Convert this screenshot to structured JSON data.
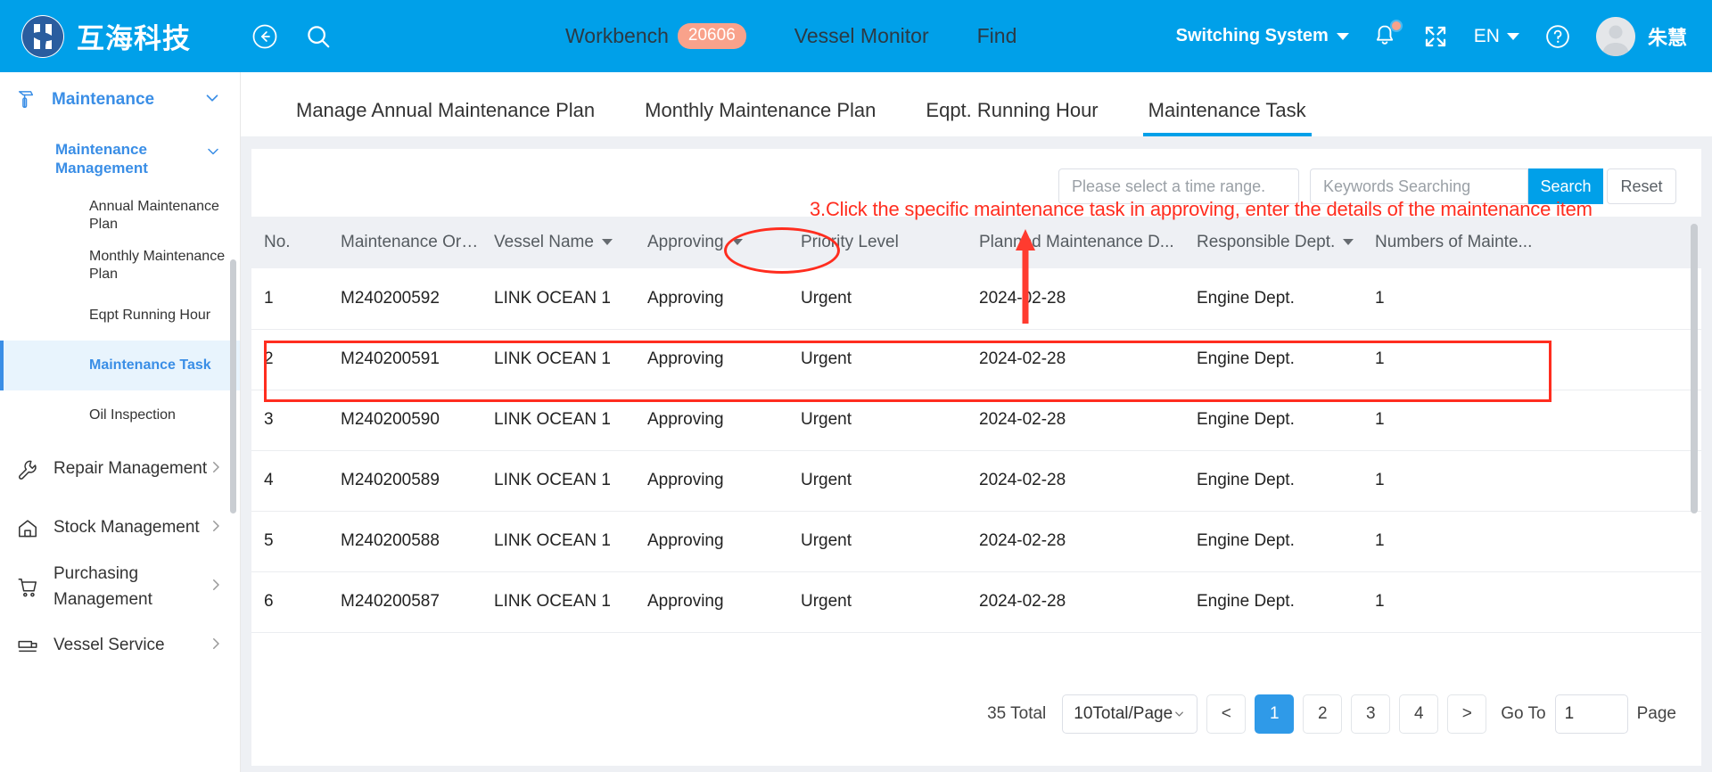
{
  "header": {
    "brand_name": "互海科技",
    "logo_icon": "company-logo-icon",
    "back_icon": "back-arrow-icon",
    "search_icon": "search-icon",
    "nav": [
      {
        "label": "Workbench",
        "badge": "20606"
      },
      {
        "label": "Vessel Monitor",
        "badge": ""
      },
      {
        "label": "Find",
        "badge": ""
      }
    ],
    "switch_system": "Switching System",
    "bell_icon": "notification-bell-icon",
    "fullscreen_icon": "fullscreen-icon",
    "language": "EN",
    "help_icon": "help-circle-icon",
    "avatar_icon": "user-avatar-icon",
    "user_name": "朱慧"
  },
  "sidebar": {
    "top": {
      "label": "Maintenance",
      "icon": "hammer-icon"
    },
    "group": {
      "label": "Maintenance Management"
    },
    "sub_items": [
      {
        "label": "Annual Maintenance Plan",
        "active": false
      },
      {
        "label": "Monthly Maintenance Plan",
        "active": false
      },
      {
        "label": "Eqpt Running Hour",
        "active": false
      },
      {
        "label": "Maintenance Task",
        "active": true
      },
      {
        "label": "Oil Inspection",
        "active": false
      }
    ],
    "items": [
      {
        "label": "Repair Management",
        "icon": "wrench-icon"
      },
      {
        "label": "Stock Management",
        "icon": "home-icon"
      },
      {
        "label": "Purchasing Management",
        "icon": "cart-icon"
      },
      {
        "label": "Vessel Service",
        "icon": "ship-icon"
      }
    ]
  },
  "main": {
    "tabs": [
      {
        "label": "Manage Annual Maintenance Plan",
        "active": false
      },
      {
        "label": "Monthly Maintenance Plan",
        "active": false
      },
      {
        "label": "Eqpt. Running Hour",
        "active": false
      },
      {
        "label": "Maintenance Task",
        "active": true
      }
    ],
    "toolbar": {
      "time_range_placeholder": "Please select a time range.",
      "keywords_placeholder": "Keywords Searching",
      "search_label": "Search",
      "reset_label": "Reset"
    },
    "table": {
      "columns": [
        {
          "label": "No.",
          "sortable": false
        },
        {
          "label": "Maintenance Order...",
          "sortable": false
        },
        {
          "label": "Vessel Name",
          "sortable": true
        },
        {
          "label": "Approving",
          "sortable": true
        },
        {
          "label": "Priority Level",
          "sortable": false
        },
        {
          "label": "Planned Maintenance D...",
          "sortable": false
        },
        {
          "label": "Responsible Dept.",
          "sortable": true
        },
        {
          "label": "Numbers of Mainte...",
          "sortable": false
        }
      ],
      "rows": [
        {
          "no": "1",
          "order": "M240200592",
          "vessel": "LINK OCEAN 1",
          "approving": "Approving",
          "priority": "Urgent",
          "date": "2024-02-28",
          "dept": "Engine Dept.",
          "numbers": "1"
        },
        {
          "no": "2",
          "order": "M240200591",
          "vessel": "LINK OCEAN 1",
          "approving": "Approving",
          "priority": "Urgent",
          "date": "2024-02-28",
          "dept": "Engine Dept.",
          "numbers": "1"
        },
        {
          "no": "3",
          "order": "M240200590",
          "vessel": "LINK OCEAN 1",
          "approving": "Approving",
          "priority": "Urgent",
          "date": "2024-02-28",
          "dept": "Engine Dept.",
          "numbers": "1"
        },
        {
          "no": "4",
          "order": "M240200589",
          "vessel": "LINK OCEAN 1",
          "approving": "Approving",
          "priority": "Urgent",
          "date": "2024-02-28",
          "dept": "Engine Dept.",
          "numbers": "1"
        },
        {
          "no": "5",
          "order": "M240200588",
          "vessel": "LINK OCEAN 1",
          "approving": "Approving",
          "priority": "Urgent",
          "date": "2024-02-28",
          "dept": "Engine Dept.",
          "numbers": "1"
        },
        {
          "no": "6",
          "order": "M240200587",
          "vessel": "LINK OCEAN 1",
          "approving": "Approving",
          "priority": "Urgent",
          "date": "2024-02-28",
          "dept": "Engine Dept.",
          "numbers": "1"
        }
      ]
    },
    "pagination": {
      "total": "35 Total",
      "page_size": "10Total/Page",
      "prev": "<",
      "pages": [
        "1",
        "2",
        "3",
        "4"
      ],
      "current_page": "1",
      "next": ">",
      "goto_label": "Go To",
      "goto_value": "1",
      "page_label": "Page"
    }
  },
  "annotations": {
    "step_text": "3.Click the specific maintenance task in approving, enter the details of the maintenance item",
    "color": "#FF2D1F"
  }
}
